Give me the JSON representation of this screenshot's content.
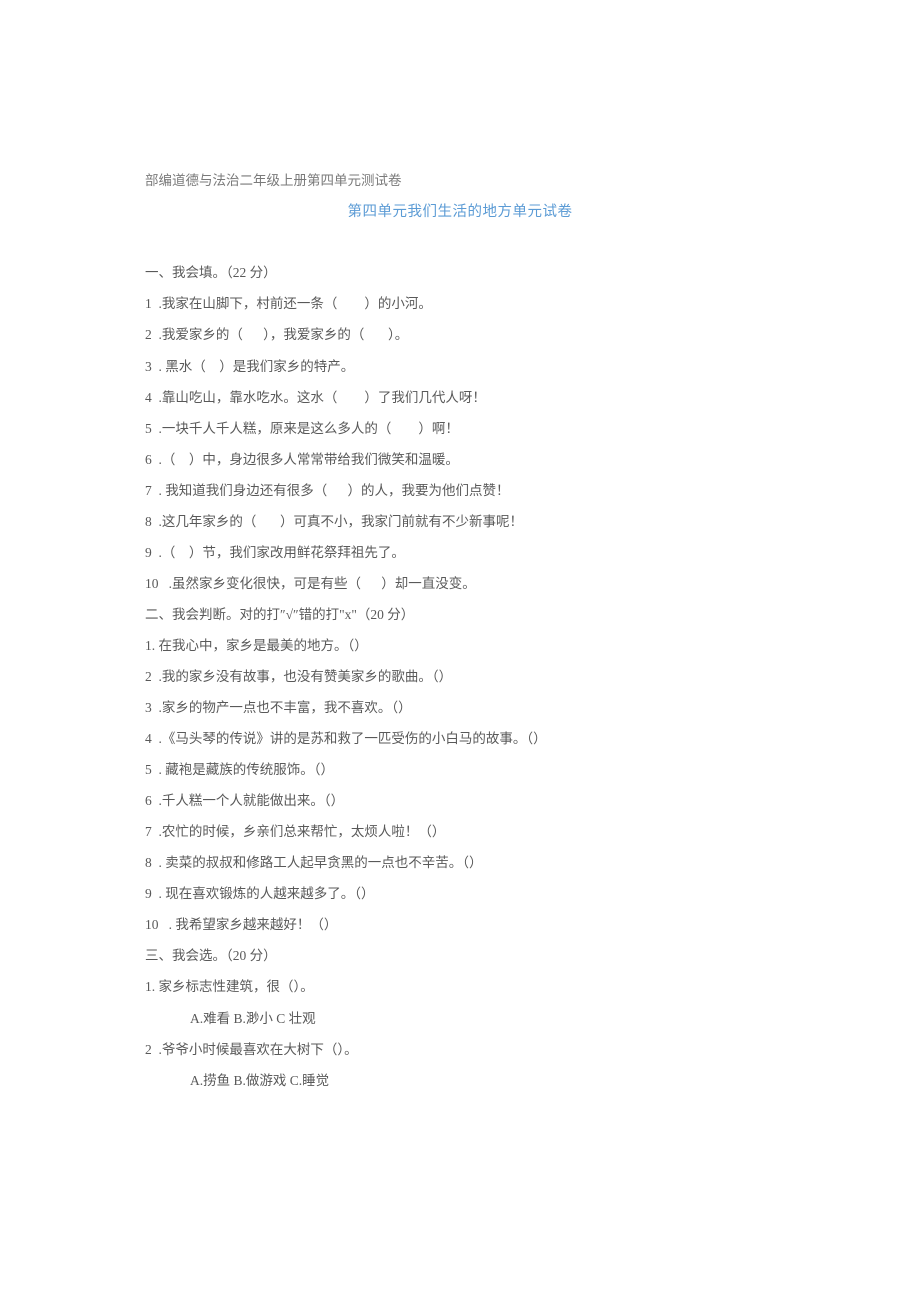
{
  "source": "部编道德与法治二年级上册第四单元测试卷",
  "title": "第四单元我们生活的地方单元试卷",
  "section1": {
    "heading": "一、我会填。（22 分）",
    "items": [
      "1  .我家在山脚下，村前还一条（        ）的小河。",
      "2  .我爱家乡的（      ），我爱家乡的（       ）。",
      "3  . 黑水（    ）是我们家乡的特产。",
      "4  .靠山吃山，靠水吃水。这水（        ）了我们几代人呀！",
      "5  .一块千人千人糕，原来是这么多人的（        ）啊！",
      "6  .（    ）中，身边很多人常常带给我们微笑和温暖。",
      "7  . 我知道我们身边还有很多（      ）的人，我要为他们点赞！",
      "8  .这几年家乡的（       ）可真不小，我家门前就有不少新事呢！",
      "9  .（    ）节，我们家改用鲜花祭拜祖先了。",
      "10   .虽然家乡变化很快，可是有些（      ）却一直没变。"
    ]
  },
  "section2": {
    "heading": "二、我会判断。对的打″√″错的打\"x\"（20 分）",
    "items": [
      "1. 在我心中，家乡是最美的地方。（）",
      "2  .我的家乡没有故事，也没有赞美家乡的歌曲。（）",
      "3  .家乡的物产一点也不丰富，我不喜欢。（）",
      "4  .《马头琴的传说》讲的是苏和救了一匹受伤的小白马的故事。（）",
      "5  . 藏袍是藏族的传统服饰。（）",
      "6  .千人糕一个人就能做出来。（）",
      "7  .农忙的时候，乡亲们总来帮忙，太烦人啦！（）",
      "8  . 卖菜的叔叔和修路工人起早贪黑的一点也不辛苦。（）",
      "9  . 现在喜欢锻炼的人越来越多了。（）",
      "10   . 我希望家乡越来越好！（）"
    ]
  },
  "section3": {
    "heading": "三、我会选。（20 分）",
    "questions": [
      {
        "stem": "1. 家乡标志性建筑，很（）。",
        "options": "A.难看 B.渺小 C 壮观"
      },
      {
        "stem": "2  .爷爷小时候最喜欢在大树下（）。",
        "options": "A.捞鱼 B.做游戏 C.睡觉"
      }
    ]
  }
}
